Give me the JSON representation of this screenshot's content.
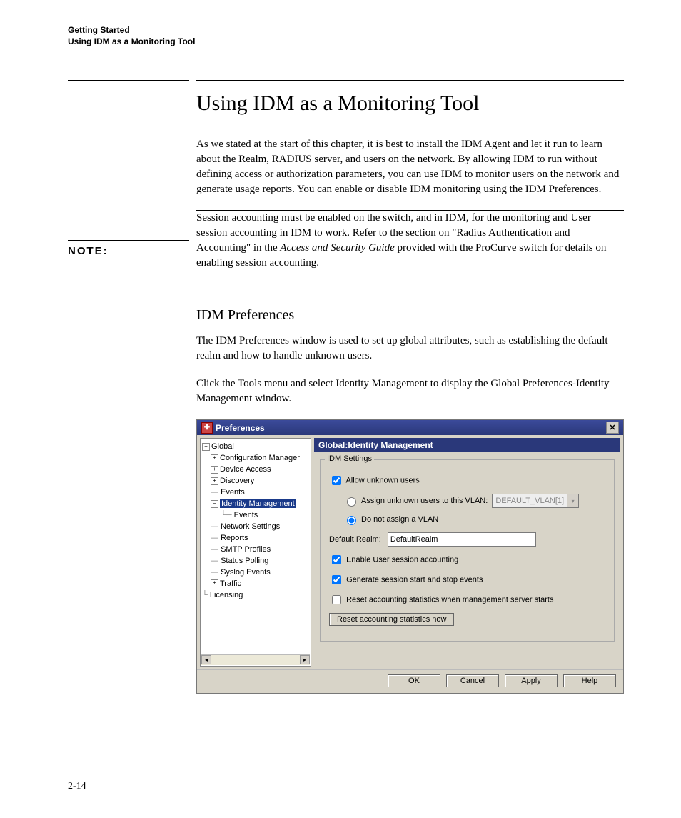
{
  "header": {
    "line1": "Getting Started",
    "line2": "Using IDM as a Monitoring Tool"
  },
  "title": "Using IDM as a Monitoring Tool",
  "intro_para": "As we stated at the start of this chapter, it is best to install the IDM Agent and let it run to learn about the Realm, RADIUS server, and users on the network. By allowing IDM to run without defining access or authorization parameters, you can use IDM to monitor users on the network and generate usage reports. You can enable or disable IDM monitoring using the IDM Preferences.",
  "note": {
    "label": "NOTE:",
    "text_before_ital": "Session accounting must be enabled on the switch, and in IDM, for the monitoring and User session accounting in IDM to work. Refer to the section on \"Radius Authentication and Accounting\" in the ",
    "ital_text": "Access and Security Guide",
    "text_after_ital": " provided with the ProCurve switch for details on enabling session accounting."
  },
  "subhead": "IDM Preferences",
  "sub_p1": "The IDM Preferences window is used to set up global attributes, such as establishing the default realm and how to handle unknown users.",
  "sub_p2": "Click the Tools menu and select Identity Management to display the Global Preferences-Identity Management window.",
  "dialog": {
    "title": "Preferences",
    "tree": {
      "global": "Global",
      "config_mgr": "Configuration Manager",
      "device_access": "Device Access",
      "discovery": "Discovery",
      "events1": "Events",
      "identity_mgmt": "Identity Management",
      "events2": "Events",
      "network_settings": "Network Settings",
      "reports": "Reports",
      "smtp": "SMTP Profiles",
      "status_polling": "Status Polling",
      "syslog": "Syslog Events",
      "traffic": "Traffic",
      "licensing": "Licensing"
    },
    "panel": {
      "header": "Global:Identity Management",
      "group_legend": "IDM Settings",
      "chk_allow": "Allow unknown users",
      "radio_assign": "Assign unknown users to this VLAN:",
      "vlan_value": "DEFAULT_VLAN[1]",
      "radio_noassign": "Do not assign a VLAN",
      "default_realm_label": "Default Realm:",
      "default_realm_value": "DefaultRealm",
      "chk_enable_acct": "Enable User session accounting",
      "chk_gen_events": "Generate session start and stop events",
      "chk_reset": "Reset accounting statistics when management server starts",
      "btn_reset_now": "Reset accounting statistics now"
    },
    "footer": {
      "ok": "OK",
      "cancel": "Cancel",
      "apply": "Apply",
      "help": "Help"
    }
  },
  "page_number": "2-14"
}
